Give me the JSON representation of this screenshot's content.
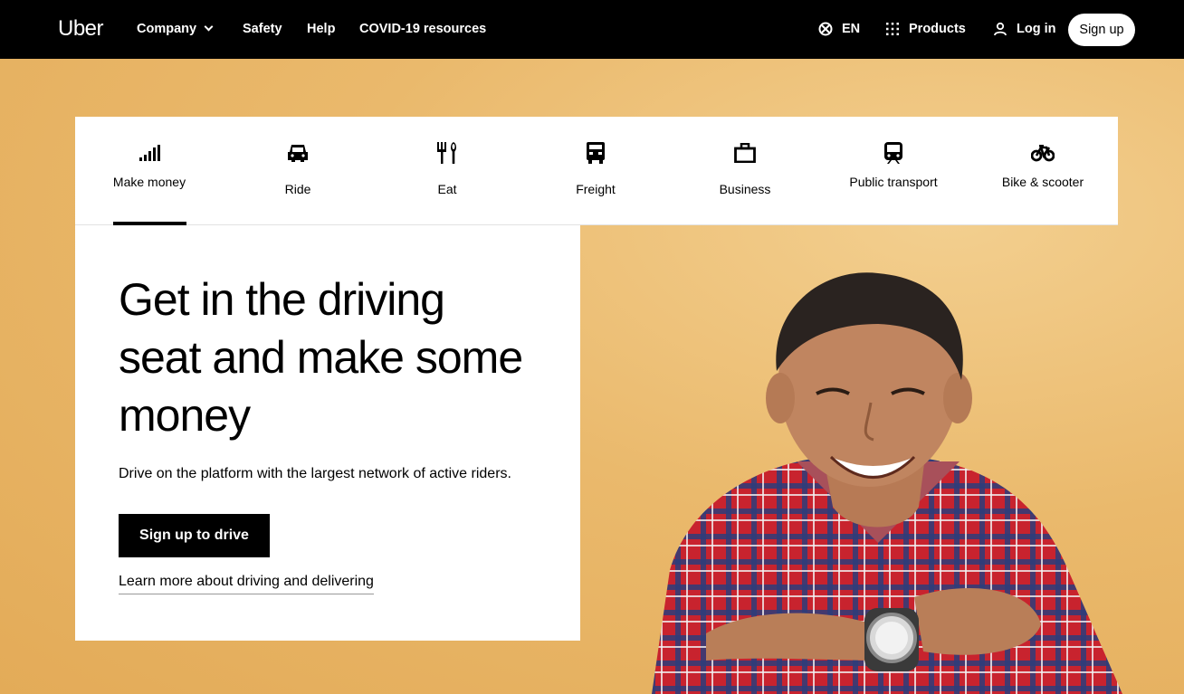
{
  "header": {
    "logo": "Uber",
    "nav": [
      "Company",
      "Safety",
      "Help",
      "COVID-19 resources"
    ],
    "language": "EN",
    "products": "Products",
    "login": "Log in",
    "signup": "Sign up"
  },
  "tabs": [
    {
      "label": "Make money",
      "icon": "signal-bars-icon",
      "selected": true
    },
    {
      "label": "Ride",
      "icon": "car-icon",
      "selected": false
    },
    {
      "label": "Eat",
      "icon": "fork-knife-icon",
      "selected": false
    },
    {
      "label": "Freight",
      "icon": "truck-icon",
      "selected": false
    },
    {
      "label": "Business",
      "icon": "briefcase-icon",
      "selected": false
    },
    {
      "label": "Public transport",
      "icon": "train-icon",
      "selected": false
    },
    {
      "label": "Bike & scooter",
      "icon": "bicycle-icon",
      "selected": false
    }
  ],
  "hero": {
    "headline": "Get in the driving seat and make some money",
    "subtext": "Drive on the platform with the largest network of active riders.",
    "cta": "Sign up to drive",
    "learn_more": "Learn more about driving and delivering"
  },
  "colors": {
    "topbar": "#000000",
    "hero_background": "#e9b96a",
    "accent": "#000000"
  }
}
